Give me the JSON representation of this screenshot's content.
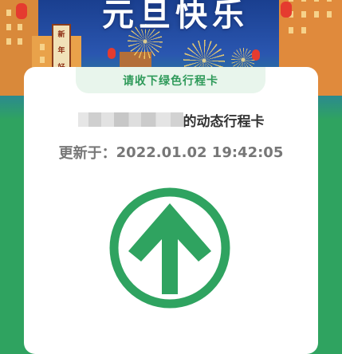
{
  "banner": {
    "title": "元旦快乐",
    "vertical_banner": [
      "新",
      "年",
      "好"
    ]
  },
  "card": {
    "tab_label": "请收下绿色行程卡",
    "phone_suffix": "的动态行程卡",
    "update_label": "更新于：",
    "update_time": "2022.01.02 19:42:05",
    "status_color": "#2fa360",
    "status_icon": "up-arrow-circle-icon"
  }
}
